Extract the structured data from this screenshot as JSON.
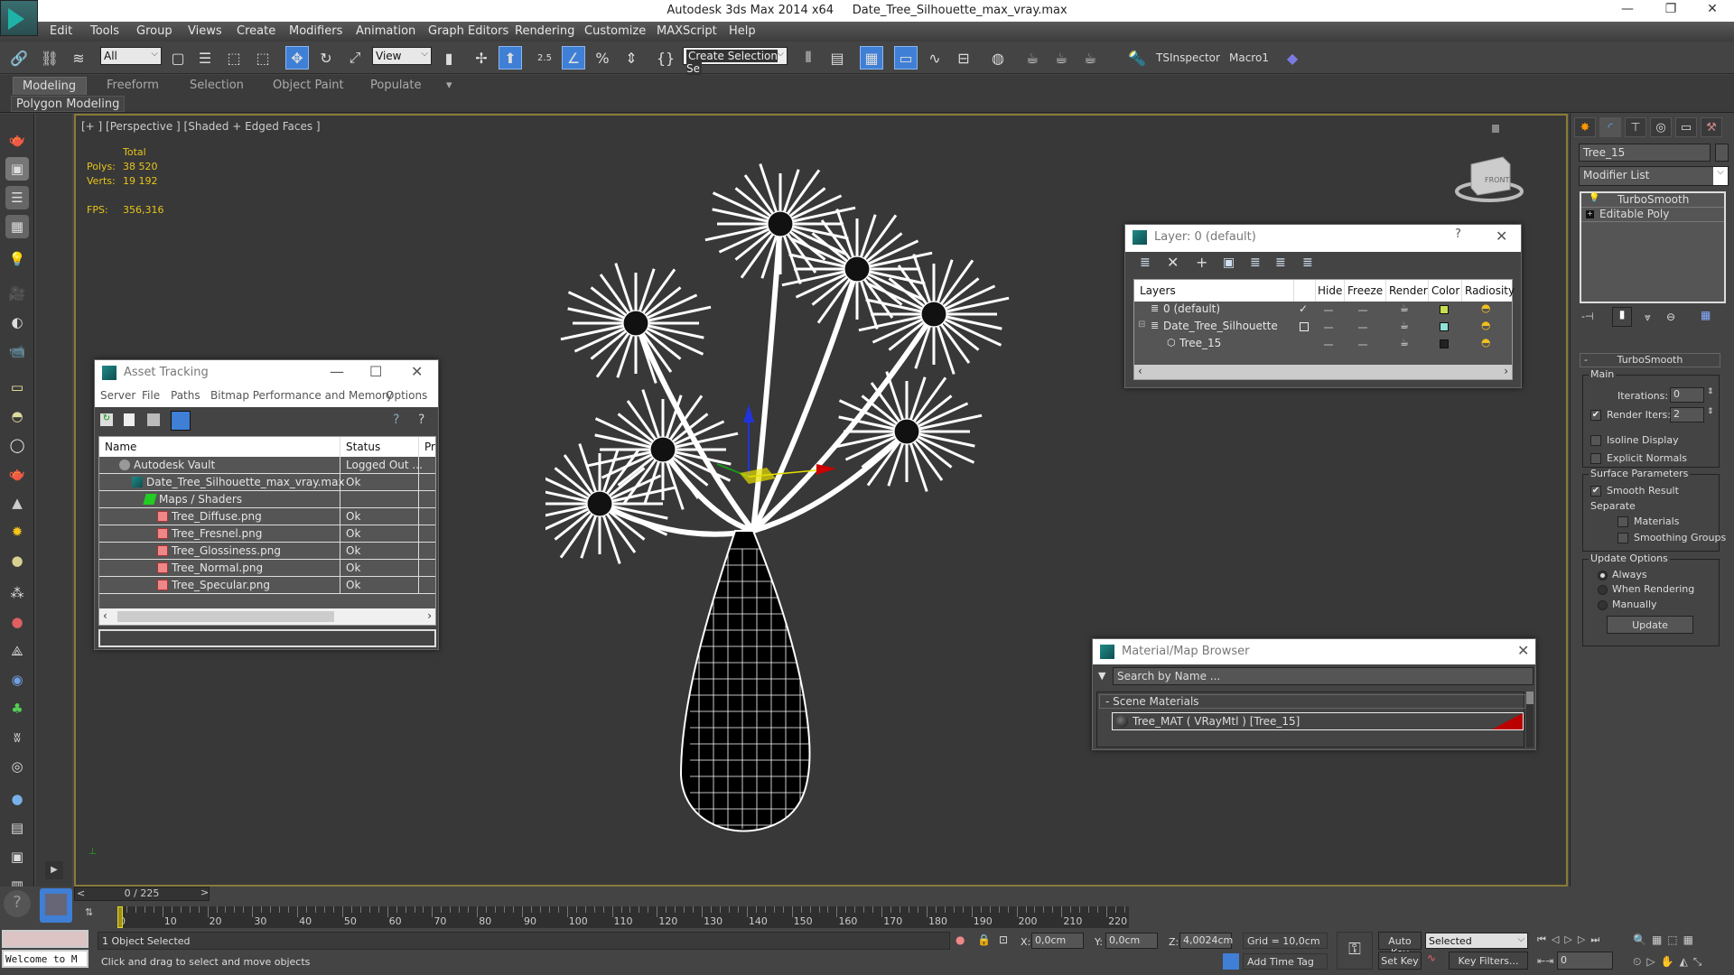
{
  "titlebar": {
    "app": "Autodesk 3ds Max  2014 x64",
    "file": "Date_Tree_Silhouette_max_vray.max"
  },
  "menu": [
    "Edit",
    "Tools",
    "Group",
    "Views",
    "Create",
    "Modifiers",
    "Animation",
    "Graph Editors",
    "Rendering",
    "Customize",
    "MAXScript",
    "Help"
  ],
  "toolbar": {
    "selection_filter": "All",
    "ref_coord": "View",
    "snap_value": "2.5",
    "named_selection_placeholder": "Create Selection Se",
    "tsinspector": "TSInspector",
    "macro1": "Macro1"
  },
  "ribbon": {
    "tabs": [
      "Modeling",
      "Freeform",
      "Selection",
      "Object Paint",
      "Populate"
    ],
    "active": "Modeling",
    "panel": "Polygon Modeling"
  },
  "viewport": {
    "label": "[+ ] [Perspective ] [Shaded + Edged Faces ]",
    "stats": {
      "total_label": "Total",
      "polys_label": "Polys:",
      "polys": "38 520",
      "verts_label": "Verts:",
      "verts": "19 192",
      "fps_label": "FPS:",
      "fps": "356,316"
    },
    "viewcube_face": "FRONT"
  },
  "asset_tracking": {
    "title": "Asset Tracking",
    "menu": [
      "Server",
      "File",
      "Paths",
      "Bitmap Performance and Memory",
      "Options"
    ],
    "columns": [
      "Name",
      "Status",
      "Pr"
    ],
    "rows": [
      {
        "name": "Autodesk Vault",
        "status": "Logged Out ...",
        "level": 1,
        "icon": "vault-icon"
      },
      {
        "name": "Date_Tree_Silhouette_max_vray.max",
        "status": "Ok",
        "level": 2,
        "icon": "max-file-icon"
      },
      {
        "name": "Maps / Shaders",
        "status": "",
        "level": 3,
        "icon": "maps-icon"
      },
      {
        "name": "Tree_Diffuse.png",
        "status": "Ok",
        "level": 4,
        "icon": "bitmap-icon"
      },
      {
        "name": "Tree_Fresnel.png",
        "status": "Ok",
        "level": 4,
        "icon": "bitmap-icon"
      },
      {
        "name": "Tree_Glossiness.png",
        "status": "Ok",
        "level": 4,
        "icon": "bitmap-icon"
      },
      {
        "name": "Tree_Normal.png",
        "status": "Ok",
        "level": 4,
        "icon": "bitmap-icon"
      },
      {
        "name": "Tree_Specular.png",
        "status": "Ok",
        "level": 4,
        "icon": "bitmap-icon"
      }
    ]
  },
  "layers": {
    "title": "Layer: 0 (default)",
    "columns": [
      "Layers",
      "",
      "Hide",
      "Freeze",
      "Render",
      "Color",
      "Radiosity"
    ],
    "rows": [
      {
        "name": "0 (default)",
        "current": "check",
        "color": "#c8e050"
      },
      {
        "name": "Date_Tree_Silhouette",
        "current": "box",
        "color": "#90e0d8"
      },
      {
        "name": "Tree_15",
        "current": "",
        "color": "#222222"
      }
    ]
  },
  "material_browser": {
    "title": "Material/Map Browser",
    "search_placeholder": "Search by Name ...",
    "section": "- Scene Materials",
    "items": [
      "Tree_MAT ( VRayMtl ) [Tree_15]"
    ]
  },
  "command_panel": {
    "object_name": "Tree_15",
    "modifier_list": "Modifier List",
    "stack": [
      "TurboSmooth",
      "Editable Poly"
    ],
    "rollout": "TurboSmooth",
    "main_group": "Main",
    "iterations_label": "Iterations:",
    "iterations": "0",
    "render_iters_label": "Render Iters:",
    "render_iters": "2",
    "isoline": "Isoline Display",
    "explicit": "Explicit Normals",
    "surface_group": "Surface Parameters",
    "smooth_result": "Smooth Result",
    "separate": "Separate",
    "materials": "Materials",
    "smoothing_groups": "Smoothing Groups",
    "update_group": "Update Options",
    "always": "Always",
    "when_rendering": "When Rendering",
    "manually": "Manually",
    "update_btn": "Update"
  },
  "timeline": {
    "frame": "0 / 225",
    "ticks": [
      "0",
      "10",
      "20",
      "30",
      "40",
      "50",
      "60",
      "70",
      "80",
      "90",
      "100",
      "110",
      "120",
      "130",
      "140",
      "150",
      "160",
      "170",
      "180",
      "190",
      "200",
      "210",
      "220"
    ]
  },
  "status": {
    "welcome": "Welcome to M",
    "selected": "1 Object Selected",
    "prompt": "Click and drag to select and move objects",
    "x_label": "X:",
    "x": "0,0cm",
    "y_label": "Y:",
    "y": "0,0cm",
    "z_label": "Z:",
    "z": "4,0024cm",
    "grid": "Grid = 10,0cm",
    "add_time_tag": "Add Time Tag",
    "auto_key": "Auto Key",
    "set_key": "Set Key",
    "key_mode": "Selected",
    "key_filters": "Key Filters...",
    "current_frame": "0"
  }
}
